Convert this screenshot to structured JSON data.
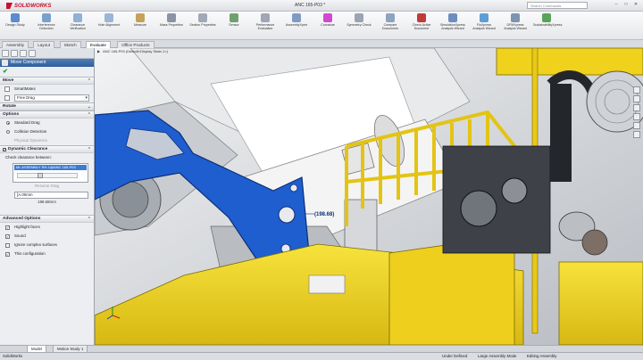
{
  "app": {
    "name": "SOLIDWORKS",
    "doc_title": "ANC 165-P03 *",
    "search_placeholder": "Search Commands"
  },
  "ribbon": [
    {
      "label": "Design Study",
      "color": "#5b8bd1"
    },
    {
      "label": "Interference Detection",
      "color": "#7aa0cc"
    },
    {
      "label": "Clearance Verification",
      "color": "#8fb0d8"
    },
    {
      "label": "Hole Alignment",
      "color": "#9bb5d5"
    },
    {
      "label": "Measure",
      "color": "#c7a15a"
    },
    {
      "label": "Mass Properties",
      "color": "#8a94a6"
    },
    {
      "label": "Section Properties",
      "color": "#a1a9b8"
    },
    {
      "label": "Sensor",
      "color": "#6fa16f"
    },
    {
      "label": "Performance Evaluation",
      "color": "#a0a7b3"
    },
    {
      "label": "AssemblyXpert",
      "color": "#7f9bc4"
    },
    {
      "label": "Curvature",
      "color": "#d04ad0"
    },
    {
      "label": "Symmetry Check",
      "color": "#9aa4b4"
    },
    {
      "label": "Compare Documents",
      "color": "#8da3c2"
    },
    {
      "label": "Check Active Document",
      "color": "#c03a3a"
    },
    {
      "label": "SimulationXpress Analysis Wizard",
      "color": "#6d8fbf"
    },
    {
      "label": "FloXpress Analysis Wizard",
      "color": "#5e9ed6"
    },
    {
      "label": "DFMXpress Analysis Wizard",
      "color": "#7e93b0"
    },
    {
      "label": "SustainabilityXpress",
      "color": "#5aa35a"
    }
  ],
  "tabs": [
    "Assembly",
    "Layout",
    "Sketch",
    "Evaluate",
    "Office Products"
  ],
  "active_tab": "Evaluate",
  "panel": {
    "title": "Move Component",
    "ok_symbol": "✔",
    "move": {
      "header": "Move",
      "smartmates": "SmartMates",
      "mode": "Free Drag"
    },
    "rotate_header": "Rotate",
    "options": {
      "header": "Options",
      "standard_drag": "Standard Drag",
      "collision_detection": "Collision Detection",
      "physical_dynamics": "Physical Dynamics"
    },
    "dynamic_clearance": {
      "header": "Dynamic Clearance",
      "check_between": "Check clearance between:",
      "component": "ML ASSEMBLY RH-1@ANC 165-P03",
      "resume_drag": "Resume Drag",
      "value1": "[A.00mm",
      "value2": "198.68mm"
    },
    "advanced": {
      "header": "Advanced Options",
      "items": [
        {
          "label": "Highlight faces",
          "checked": "✓"
        },
        {
          "label": "Sound",
          "checked": "✓"
        },
        {
          "label": "Ignore complex surfaces",
          "checked": ""
        },
        {
          "label": "This configuration",
          "checked": "✓"
        }
      ]
    }
  },
  "viewport": {
    "breadcrumb": "ANC 165-P03 (Default<Display State-1>)",
    "dimension": "(198.68)"
  },
  "bottom_tabs": [
    "Model",
    "Motion Study 1"
  ],
  "status": {
    "app": "SolidWorks",
    "under_defined": "Under Defined",
    "large_mode": "Large Assembly Mode",
    "editing": "Editing Assembly"
  },
  "colors": {
    "accent_blue": "#1f5ecf",
    "yellow": "#f2d21a",
    "panel_header": "#2f5e9a"
  }
}
